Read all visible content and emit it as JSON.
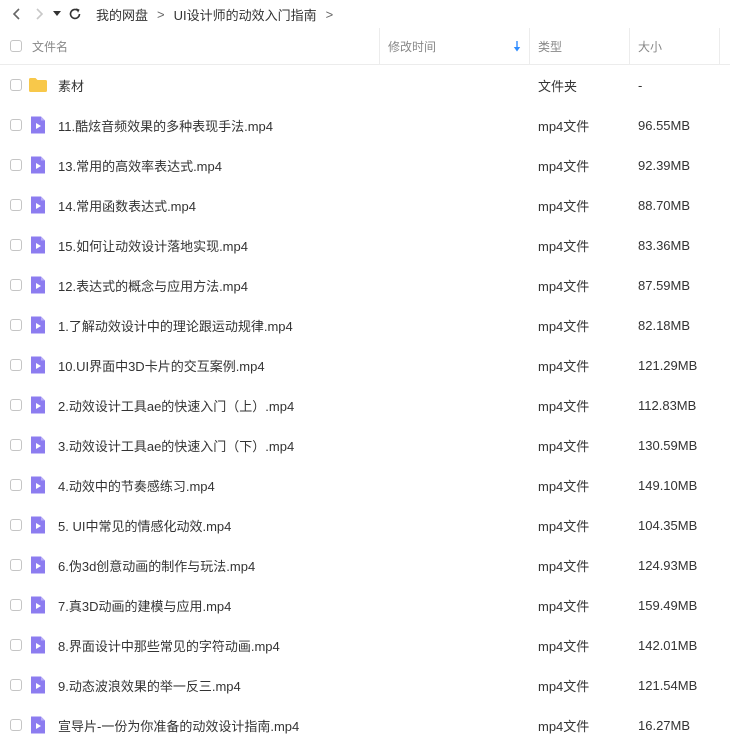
{
  "breadcrumb": [
    "我的网盘",
    "UI设计师的动效入门指南"
  ],
  "columns": {
    "name": "文件名",
    "modified": "修改时间",
    "type": "类型",
    "size": "大小"
  },
  "colors": {
    "folder": "#f8c84a",
    "video": "#8c7cf0",
    "sort_arrow": "#2f8cff"
  },
  "files": [
    {
      "name": "素材",
      "type": "文件夹",
      "size": "-",
      "icon": "folder-icon"
    },
    {
      "name": "11.酷炫音频效果的多种表现手法.mp4",
      "type": "mp4文件",
      "size": "96.55MB",
      "icon": "video-file-icon"
    },
    {
      "name": "13.常用的高效率表达式.mp4",
      "type": "mp4文件",
      "size": "92.39MB",
      "icon": "video-file-icon"
    },
    {
      "name": "14.常用函数表达式.mp4",
      "type": "mp4文件",
      "size": "88.70MB",
      "icon": "video-file-icon"
    },
    {
      "name": "15.如何让动效设计落地实现.mp4",
      "type": "mp4文件",
      "size": "83.36MB",
      "icon": "video-file-icon"
    },
    {
      "name": "12.表达式的概念与应用方法.mp4",
      "type": "mp4文件",
      "size": "87.59MB",
      "icon": "video-file-icon"
    },
    {
      "name": "1.了解动效设计中的理论跟运动规律.mp4",
      "type": "mp4文件",
      "size": "82.18MB",
      "icon": "video-file-icon"
    },
    {
      "name": "10.UI界面中3D卡片的交互案例.mp4",
      "type": "mp4文件",
      "size": "121.29MB",
      "icon": "video-file-icon"
    },
    {
      "name": "2.动效设计工具ae的快速入门（上）.mp4",
      "type": "mp4文件",
      "size": "112.83MB",
      "icon": "video-file-icon"
    },
    {
      "name": "3.动效设计工具ae的快速入门（下）.mp4",
      "type": "mp4文件",
      "size": "130.59MB",
      "icon": "video-file-icon"
    },
    {
      "name": "4.动效中的节奏感练习.mp4",
      "type": "mp4文件",
      "size": "149.10MB",
      "icon": "video-file-icon"
    },
    {
      "name": "5. UI中常见的情感化动效.mp4",
      "type": "mp4文件",
      "size": "104.35MB",
      "icon": "video-file-icon"
    },
    {
      "name": "6.伪3d创意动画的制作与玩法.mp4",
      "type": "mp4文件",
      "size": "124.93MB",
      "icon": "video-file-icon"
    },
    {
      "name": "7.真3D动画的建模与应用.mp4",
      "type": "mp4文件",
      "size": "159.49MB",
      "icon": "video-file-icon"
    },
    {
      "name": "8.界面设计中那些常见的字符动画.mp4",
      "type": "mp4文件",
      "size": "142.01MB",
      "icon": "video-file-icon"
    },
    {
      "name": "9.动态波浪效果的举一反三.mp4",
      "type": "mp4文件",
      "size": "121.54MB",
      "icon": "video-file-icon"
    },
    {
      "name": "宣导片-一份为你准备的动效设计指南.mp4",
      "type": "mp4文件",
      "size": "16.27MB",
      "icon": "video-file-icon"
    }
  ]
}
